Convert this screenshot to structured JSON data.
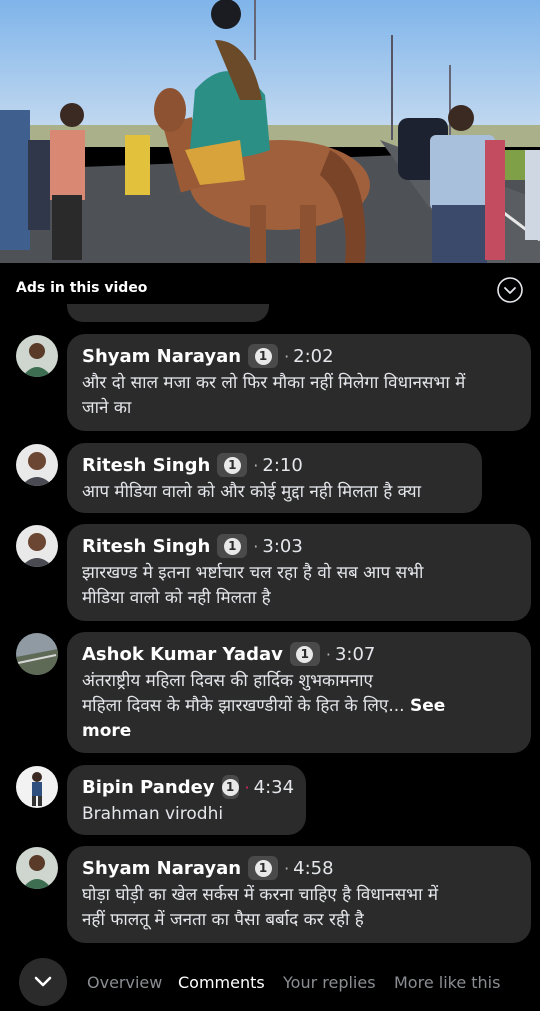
{
  "video": {
    "label": "video-frame"
  },
  "ads": {
    "label": "Ads in this video"
  },
  "comments": [
    {
      "name": "Shyam Narayan",
      "badge": "1",
      "sep": "·",
      "time": "2:02",
      "lines": [
        "और दो साल मजा कर लो फिर मौका नहीं मिलेगा विधानसभा में",
        "जाने का"
      ]
    },
    {
      "name": "Ritesh Singh",
      "badge": "1",
      "sep": "·",
      "time": "2:10",
      "lines": [
        "आप मीडिया वालो को और कोई मुद्दा नही मिलता है क्या"
      ]
    },
    {
      "name": "Ritesh Singh",
      "badge": "1",
      "sep": "·",
      "time": "3:03",
      "lines": [
        "झारखण्ड मे इतना भर्ष्टाचार चल रहा है वो सब आप सभी",
        "मीडिया वालो को नही मिलता है"
      ]
    },
    {
      "name": "Ashok Kumar Yadav",
      "badge": "1",
      "sep": "·",
      "time": "3:07",
      "lines": [
        "अंतराष्ट्रीय महिला दिवस की हार्दिक शुभकामनाए",
        "महिला दिवस के मौके झारखण्डीयों के हित के लिए..."
      ],
      "see_more": "See",
      "see_more_2": "more"
    },
    {
      "name": "Bipin Pandey",
      "badge": "1",
      "sep": "·",
      "time": "4:34",
      "lines": [
        "Brahman virodhi"
      ],
      "sep_color": "#e0245e"
    },
    {
      "name": "Shyam Narayan",
      "badge": "1",
      "sep": "·",
      "time": "4:58",
      "lines": [
        "घोड़ा घोड़ी का खेल सर्कस में करना चाहिए है विधानसभा में",
        "नहीं फालतू में जनता का पैसा बर्बाद कर रही है"
      ]
    }
  ],
  "nav": {
    "tabs": [
      "Overview",
      "Comments",
      "Your replies",
      "More like this"
    ],
    "active": "Comments"
  },
  "colors": {
    "bubble": "#2b2b2b",
    "background": "#000000",
    "inactive_tab": "#8a8d91"
  }
}
